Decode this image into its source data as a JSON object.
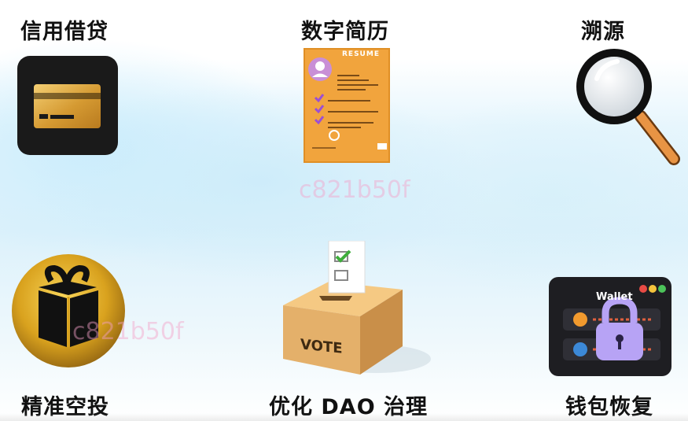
{
  "features": {
    "credit": {
      "label": "信用借贷",
      "icon": "credit-card-icon"
    },
    "resume": {
      "label": "数字简历",
      "icon": "resume-document-icon",
      "doc_title": "RESUME"
    },
    "trace": {
      "label": "溯源",
      "icon": "magnifier-icon"
    },
    "airdrop": {
      "label": "精准空投",
      "icon": "gift-box-icon"
    },
    "dao": {
      "label": "优化 DAO 治理",
      "icon": "ballot-box-icon",
      "box_text": "VOTE"
    },
    "wallet": {
      "label": "钱包恢复",
      "icon": "wallet-lock-icon",
      "wallet_title": "Wallet"
    }
  },
  "watermarks": {
    "top": "c821b50f",
    "left": "c821b50f"
  },
  "colors": {
    "gold": "#d8a43c",
    "orange": "#f3a63e",
    "purple": "#b7a3f5",
    "box": "#e9b66a",
    "dark": "#1b1b1b"
  }
}
